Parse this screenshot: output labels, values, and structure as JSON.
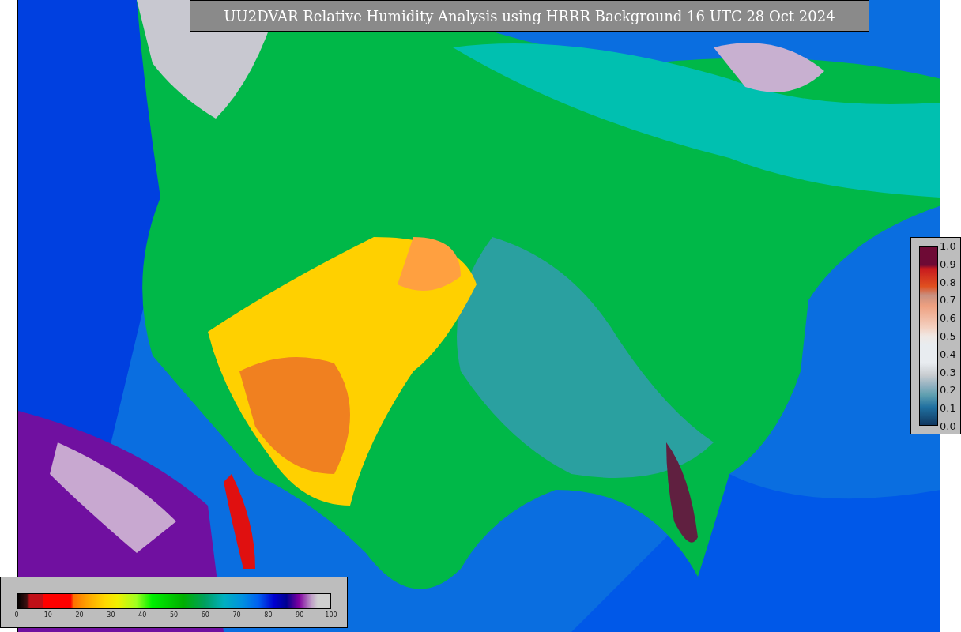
{
  "title": "UU2DVAR Relative Humidity Analysis using HRRR Background 16 UTC 28 Oct 2024",
  "humidity_legend": {
    "ticks": [
      "0",
      "10",
      "20",
      "30",
      "40",
      "50",
      "60",
      "70",
      "80",
      "90",
      "100"
    ]
  },
  "observation_legend": {
    "ticks": [
      "1.0",
      "0.9",
      "0.8",
      "0.7",
      "0.6",
      "0.5",
      "0.4",
      "0.3",
      "0.2",
      "0.1",
      "0.0"
    ]
  }
}
